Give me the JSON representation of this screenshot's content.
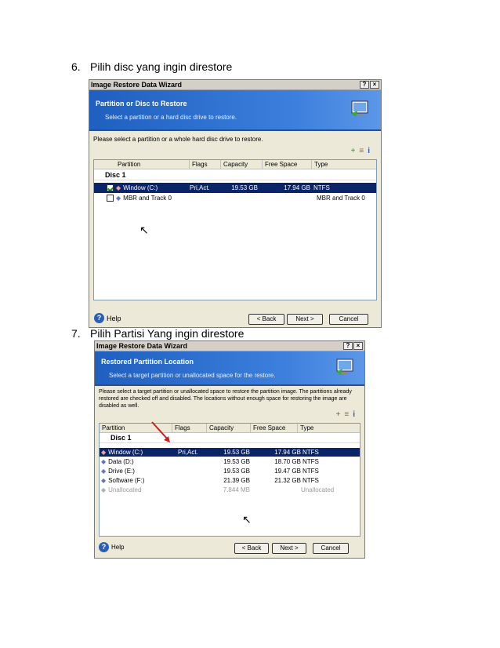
{
  "steps": [
    {
      "num": "6.",
      "text": "Pilih disc yang ingin direstore"
    },
    {
      "num": "7.",
      "text": "Pilih Partisi Yang ingin direstore"
    }
  ],
  "titlebar_buttons": {
    "help": "?",
    "close": "×"
  },
  "icons": {
    "add": "+",
    "props": "≡",
    "info": "i",
    "cursor": "↖"
  },
  "dialog1": {
    "title": "Image Restore Data Wizard",
    "banner_title": "Partition or Disc to Restore",
    "banner_sub": "Select a partition or a hard disc drive to restore.",
    "description": "Please select a partition or a whole hard disc drive to restore.",
    "columns": [
      "Partition",
      "Flags",
      "Capacity",
      "Free Space",
      "Type"
    ],
    "disc_label": "Disc 1",
    "rows": [
      {
        "partition": "Window (C:)",
        "flags": "Pri,Act.",
        "capacity": "19.53 GB",
        "free": "17.94 GB",
        "type": "NTFS"
      },
      {
        "partition": "MBR and Track 0",
        "flags": "",
        "capacity": "",
        "free": "",
        "type": "MBR and Track 0"
      }
    ],
    "buttons": {
      "help": "Help",
      "back": "< Back",
      "next": "Next >",
      "cancel": "Cancel"
    }
  },
  "dialog2": {
    "title": "Image Restore Data Wizard",
    "banner_title": "Restored Partition Location",
    "banner_sub": "Select a target partition or unallocated space for the restore.",
    "description": "Please select a target partition or unallocated space to restore the partition image. The partitions already restored are checked off and disabled. The locations without enough space for restoring the image are disabled as well.",
    "columns": [
      "Partition",
      "Flags",
      "Capacity",
      "Free Space",
      "Type"
    ],
    "disc_label": "Disc 1",
    "rows": [
      {
        "partition": "Window (C:)",
        "flags": "Pri,Act.",
        "capacity": "19.53 GB",
        "free": "17.94 GB",
        "type": "NTFS"
      },
      {
        "partition": "Data (D:)",
        "flags": "",
        "capacity": "19.53 GB",
        "free": "18.70 GB",
        "type": "NTFS"
      },
      {
        "partition": "Drive (E:)",
        "flags": "",
        "capacity": "19.53 GB",
        "free": "19.47 GB",
        "type": "NTFS"
      },
      {
        "partition": "Software (F:)",
        "flags": "",
        "capacity": "21.39 GB",
        "free": "21.32 GB",
        "type": "NTFS"
      },
      {
        "partition": "Unallocated",
        "flags": "",
        "capacity": "7.844 MB",
        "free": "",
        "type": "Unallocated"
      }
    ],
    "buttons": {
      "help": "Help",
      "back": "< Back",
      "next": "Next >",
      "cancel": "Cancel"
    }
  }
}
